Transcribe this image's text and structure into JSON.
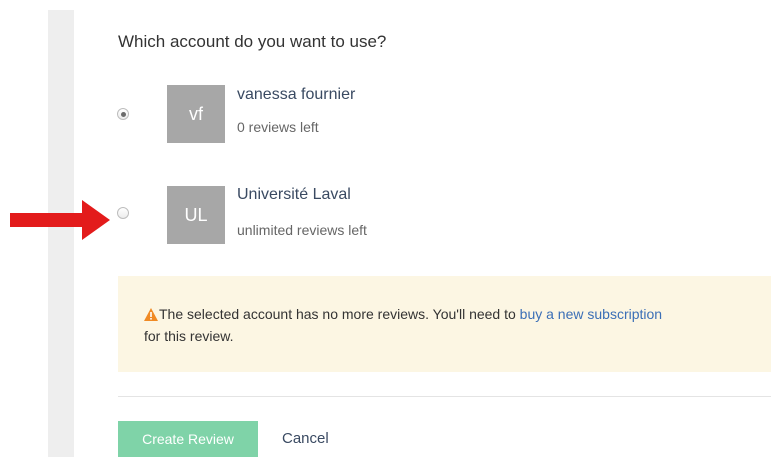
{
  "question": "Which account do you want to use?",
  "accounts": [
    {
      "initials": "vf",
      "name": "vanessa fournier",
      "reviews_left": "0 reviews left",
      "selected": true
    },
    {
      "initials": "UL",
      "name": "Université Laval",
      "reviews_left": "unlimited reviews left",
      "selected": false
    }
  ],
  "notice": {
    "icon": "warning-triangle-icon",
    "text_before": "The selected account has no more reviews. You'll need to ",
    "link_text": "buy a new subscription",
    "text_after": "for this review."
  },
  "actions": {
    "create_label": "Create Review",
    "cancel_label": "Cancel"
  },
  "colors": {
    "arrow": "#e31b1b",
    "create_button": "#7fd3a8",
    "notice_background": "#fcf6e3",
    "warning_icon": "#f08a24",
    "avatar": "#a7a7a7",
    "link": "#3b6fb6"
  }
}
